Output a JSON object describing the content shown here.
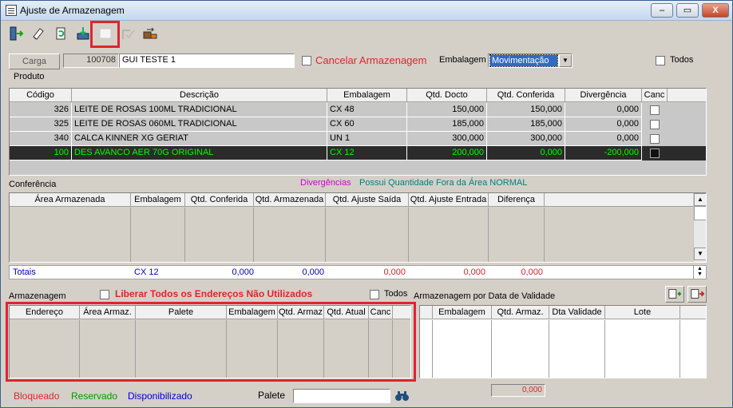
{
  "window": {
    "title": "Ajuste de Armazenagem",
    "minimize": "‒",
    "maximize": "▭",
    "close": "X"
  },
  "toolbar": {
    "icons": [
      "exit-icon",
      "eraser-icon",
      "refresh-icon",
      "save-icon",
      "blank-icon",
      "check-icon",
      "transfer-icon"
    ]
  },
  "carga": {
    "button": "Carga",
    "code": "100708",
    "name": "GUI TESTE 1"
  },
  "cancelar_label": "Cancelar Armazenagem",
  "embalagem_label": "Embalagem",
  "embalagem_value": "Movimentação",
  "todos_label": "Todos",
  "produto_label": "Produto",
  "produto_grid": {
    "headers": [
      "Código",
      "Descrição",
      "Embalagem",
      "Qtd. Docto",
      "Qtd. Conferida",
      "Divergência",
      "Canc"
    ],
    "rows": [
      [
        "326",
        "LEITE DE ROSAS 100ML TRADICIONAL",
        "CX 48",
        "150,000",
        "150,000",
        "0,000"
      ],
      [
        "325",
        "LEITE DE ROSAS 060ML TRADICIONAL",
        "CX 60",
        "185,000",
        "185,000",
        "0,000"
      ],
      [
        "340",
        "CALCA KINNER XG GERIAT",
        "UN 1",
        "300,000",
        "300,000",
        "0,000"
      ],
      [
        "100",
        "DES AVANCO AER 70G ORIGINAL",
        "CX 12",
        "200,000",
        "0,000",
        "-200,000"
      ]
    ]
  },
  "conferencia": {
    "label": "Conferência",
    "legend_div": "Divergências",
    "legend_fora": "Possui Quantidade Fora da Área NORMAL",
    "headers": [
      "Área Armazenada",
      "Embalagem",
      "Qtd. Conferida",
      "Qtd. Armazenada",
      "Qtd. Ajuste Saída",
      "Qtd. Ajuste Entrada",
      "Diferença"
    ],
    "totais": {
      "label": "Totais",
      "embalagem": "CX 12",
      "conferida": "0,000",
      "armazenada": "0,000",
      "saida": "0,000",
      "entrada": "0,000",
      "diferenca": "0,000"
    }
  },
  "armazenagem": {
    "label": "Armazenagem",
    "liberar_label": "Liberar Todos os Endereços Não Utilizados",
    "todos_label": "Todos",
    "headers": [
      "Endereço",
      "Área Armaz.",
      "Palete",
      "Embalagem",
      "Qtd. Armaz",
      "Qtd. Atual",
      "Canc"
    ]
  },
  "validade": {
    "label": "Armazenagem por Data de Validade",
    "headers": [
      "Embalagem",
      "Qtd. Armaz.",
      "Dta Validade",
      "Lote"
    ],
    "total": "0,000"
  },
  "legend": {
    "bloqueado": "Bloqueado",
    "reservado": "Reservado",
    "disponibilizado": "Disponibilizado"
  },
  "palete_label": "Palete",
  "colors": {
    "red": "#e0242d",
    "green": "#009900",
    "blue": "#0000cc",
    "selected_bg": "#2b2b2b",
    "selected_fg": "#00ff00",
    "magenta": "#cc00cc",
    "teal": "#008080"
  }
}
